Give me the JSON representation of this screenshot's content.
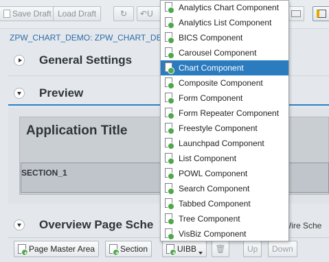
{
  "toolbar": {
    "save_draft": "Save Draft",
    "load_draft": "Load Draft",
    "undo_partial": "U"
  },
  "breadcrumb": "ZPW_CHART_DEMO: ZPW_CHART_DE",
  "panels": {
    "general_settings": "General Settings",
    "preview": "Preview",
    "overview": "Overview Page Sche"
  },
  "preview": {
    "app_title": "Application Title",
    "section_label": "SECTION_1"
  },
  "wire_text": "Wire Sche",
  "bottom_buttons": {
    "page_master_area": "Page Master Area",
    "section": "Section",
    "uibb": "UIBB",
    "up": "Up",
    "down": "Down"
  },
  "menu": {
    "selected_index": 4,
    "items": [
      "Analytics Chart Component",
      "Analytics List Component",
      "BICS Component",
      "Carousel Component",
      "Chart Component",
      "Composite Component",
      "Form Component",
      "Form Repeater Component",
      "Freestyle Component",
      "Launchpad Component",
      "List Component",
      "POWL Component",
      "Search Component",
      "Tabbed Component",
      "Tree Component",
      "VisBiz Component"
    ]
  },
  "colors": {
    "accent": "#2b7bbf",
    "link": "#2b6aa8",
    "add_icon": "#4da84a"
  }
}
